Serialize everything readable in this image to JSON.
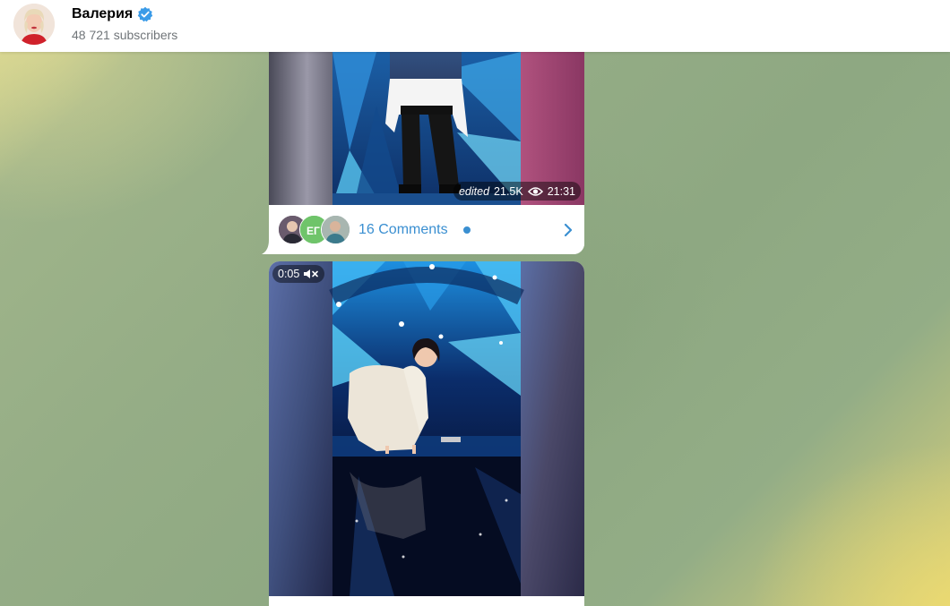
{
  "header": {
    "channel_name": "Валерия",
    "subscribers": "48 721 subscribers",
    "verified_icon": "verified-badge-icon",
    "avatar": "channel-avatar"
  },
  "posts": [
    {
      "meta": {
        "edited": "edited",
        "views": "21.5K",
        "time": "21:31"
      },
      "comments": {
        "label": "16 Comments",
        "icon": "chevron-right-icon"
      }
    },
    {
      "video": {
        "duration": "0:05",
        "icon": "muted-speaker-icon"
      }
    }
  ],
  "colors": {
    "accent": "#3a8fd1",
    "verified": "#3a9be8",
    "bubble": "#ffffff",
    "subtext": "#707579"
  }
}
